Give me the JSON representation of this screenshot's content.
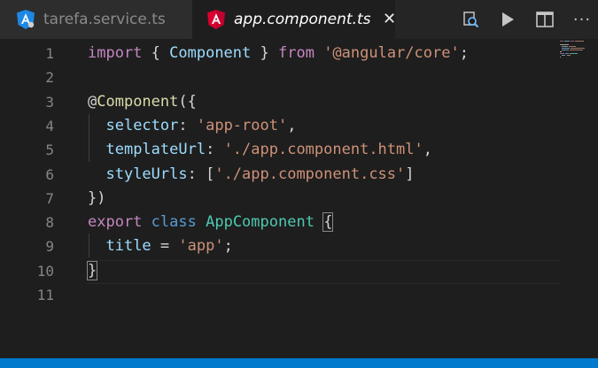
{
  "tabs": [
    {
      "label": "tarefa.service.ts",
      "icon": "angular-service-icon",
      "active": false
    },
    {
      "label": "app.component.ts",
      "icon": "angular-icon",
      "active": true,
      "close": "✕"
    }
  ],
  "actions": {
    "more": "···",
    "icons": [
      "open-changes-icon",
      "run-icon",
      "split-editor-icon",
      "more-actions-icon"
    ]
  },
  "editor": {
    "line_numbers": [
      "1",
      "2",
      "3",
      "4",
      "5",
      "6",
      "7",
      "8",
      "9",
      "10",
      "11"
    ],
    "lines": [
      [
        [
          "kw",
          "import"
        ],
        [
          "punc",
          " { "
        ],
        [
          "prop",
          "Component"
        ],
        [
          "punc",
          " } "
        ],
        [
          "kw",
          "from"
        ],
        [
          "punc",
          " "
        ],
        [
          "str",
          "'@angular/core'"
        ],
        [
          "punc",
          ";"
        ]
      ],
      [],
      [
        [
          "punc",
          "@"
        ],
        [
          "dec",
          "Component"
        ],
        [
          "punc",
          "({"
        ]
      ],
      [
        [
          "punc",
          "  "
        ],
        [
          "prop",
          "selector"
        ],
        [
          "punc",
          ": "
        ],
        [
          "str",
          "'app-root'"
        ],
        [
          "punc",
          ","
        ]
      ],
      [
        [
          "punc",
          "  "
        ],
        [
          "prop",
          "templateUrl"
        ],
        [
          "punc",
          ": "
        ],
        [
          "str",
          "'./app.component.html'"
        ],
        [
          "punc",
          ","
        ]
      ],
      [
        [
          "punc",
          "  "
        ],
        [
          "prop",
          "styleUrls"
        ],
        [
          "punc",
          ": ["
        ],
        [
          "str",
          "'./app.component.css'"
        ],
        [
          "punc",
          "]"
        ]
      ],
      [
        [
          "punc",
          "})"
        ]
      ],
      [
        [
          "kw",
          "export"
        ],
        [
          "punc",
          " "
        ],
        [
          "kwb",
          "class"
        ],
        [
          "punc",
          " "
        ],
        [
          "cls",
          "AppComponent"
        ],
        [
          "punc",
          " "
        ],
        [
          "bm",
          "{"
        ]
      ],
      [
        [
          "punc",
          "  "
        ],
        [
          "prop",
          "title"
        ],
        [
          "punc",
          " = "
        ],
        [
          "str",
          "'app'"
        ],
        [
          "punc",
          ";"
        ]
      ],
      [
        [
          "bm",
          "}"
        ]
      ],
      []
    ]
  },
  "colors": {
    "keyword": "#c586c0",
    "keyword_blue": "#569cd6",
    "class": "#4ec9b0",
    "string": "#ce9178",
    "property": "#9cdcfe",
    "decorator": "#dcdcaa",
    "status_bar": "#007acc",
    "angular_red": "#dd0031",
    "angular_blue": "#1e88e5"
  }
}
